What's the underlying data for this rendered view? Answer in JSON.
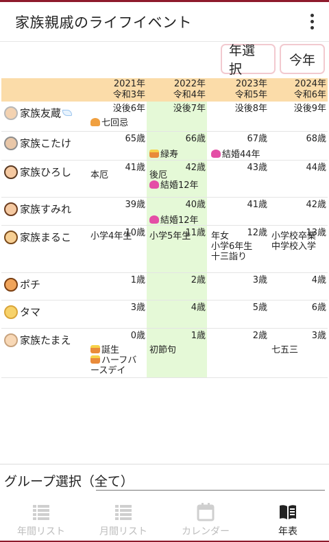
{
  "app": {
    "title": "家族親戚のライフイベント"
  },
  "buttons": {
    "year_select": "年選択",
    "this_year": "今年"
  },
  "years": [
    {
      "western": "2021年",
      "era": "令和3年"
    },
    {
      "western": "2022年",
      "era": "令和4年"
    },
    {
      "western": "2023年",
      "era": "令和5年"
    },
    {
      "western": "2024年",
      "era": "令和6年"
    }
  ],
  "rows": [
    {
      "name": "家族友蔵",
      "face": "elder-man-icon",
      "cells": [
        {
          "age": "没後6年",
          "events": [
            {
              "icon": "memorial-icon",
              "text": "七回忌"
            }
          ]
        },
        {
          "age": "没後7年",
          "events": []
        },
        {
          "age": "没後8年",
          "events": []
        },
        {
          "age": "没後9年",
          "events": []
        }
      ]
    },
    {
      "name": "家族こたけ",
      "face": "elder-woman-icon",
      "cells": [
        {
          "age": "65歳",
          "events": []
        },
        {
          "age": "66歳",
          "events": [
            {
              "icon": "cake-icon",
              "text": "緑寿"
            }
          ]
        },
        {
          "age": "67歳",
          "events": [
            {
              "icon": "hearts-icon",
              "text": "結婚44年"
            }
          ]
        },
        {
          "age": "68歳",
          "events": []
        }
      ]
    },
    {
      "name": "家族ひろし",
      "face": "man-icon",
      "cells": [
        {
          "age": "41歳",
          "events": [
            {
              "icon": "",
              "text": "本厄"
            }
          ]
        },
        {
          "age": "42歳",
          "events": [
            {
              "icon": "",
              "text": "後厄"
            },
            {
              "icon": "hearts-icon",
              "text": "結婚12年"
            }
          ]
        },
        {
          "age": "43歳",
          "events": []
        },
        {
          "age": "44歳",
          "events": []
        }
      ]
    },
    {
      "name": "家族すみれ",
      "face": "woman-icon",
      "cells": [
        {
          "age": "39歳",
          "events": []
        },
        {
          "age": "40歳",
          "events": [
            {
              "icon": "hearts-icon",
              "text": "結婚12年"
            }
          ]
        },
        {
          "age": "41歳",
          "events": []
        },
        {
          "age": "42歳",
          "events": []
        }
      ]
    },
    {
      "name": "家族まるこ",
      "face": "girl-icon",
      "cells": [
        {
          "age": "10歳",
          "events": [
            {
              "icon": "",
              "text": "小学4年生"
            }
          ]
        },
        {
          "age": "11歳",
          "events": [
            {
              "icon": "",
              "text": "小学5年生"
            }
          ]
        },
        {
          "age": "12歳",
          "events": [
            {
              "icon": "",
              "text": "年女"
            },
            {
              "icon": "",
              "text": "小学6年生"
            },
            {
              "icon": "",
              "text": "十三詣り"
            }
          ]
        },
        {
          "age": "13歳",
          "events": [
            {
              "icon": "",
              "text": "小学校卒業"
            },
            {
              "icon": "",
              "text": "中学校入学"
            }
          ]
        }
      ]
    },
    {
      "name": "ポチ",
      "face": "dog-icon",
      "cells": [
        {
          "age": "1歳",
          "events": []
        },
        {
          "age": "2歳",
          "events": []
        },
        {
          "age": "3歳",
          "events": []
        },
        {
          "age": "4歳",
          "events": []
        }
      ]
    },
    {
      "name": "タマ",
      "face": "cat-icon",
      "cells": [
        {
          "age": "3歳",
          "events": []
        },
        {
          "age": "4歳",
          "events": []
        },
        {
          "age": "5歳",
          "events": []
        },
        {
          "age": "6歳",
          "events": []
        }
      ]
    },
    {
      "name": "家族たまえ",
      "face": "baby-icon",
      "cells": [
        {
          "age": "0歳",
          "events": [
            {
              "icon": "cake-icon",
              "text": "誕生"
            },
            {
              "icon": "cake-icon",
              "text": "ハーフバ"
            },
            {
              "icon": "",
              "text": "ースデイ"
            }
          ]
        },
        {
          "age": "1歳",
          "events": [
            {
              "icon": "",
              "text": "初節句"
            }
          ]
        },
        {
          "age": "2歳",
          "events": []
        },
        {
          "age": "3歳",
          "events": [
            {
              "icon": "",
              "text": "七五三"
            }
          ]
        }
      ]
    }
  ],
  "group": {
    "label": "グループ選択（全て）"
  },
  "tabs": [
    {
      "label": "年間リスト",
      "icon": "list-icon",
      "active": false
    },
    {
      "label": "月間リスト",
      "icon": "list-icon",
      "active": false
    },
    {
      "label": "カレンダー",
      "icon": "calendar-icon",
      "active": false
    },
    {
      "label": "年表",
      "icon": "book-icon",
      "active": true
    }
  ],
  "colors": {
    "accent": "#8e1a2c",
    "header_bg": "#fbdca9",
    "highlight": "#e5f9d7",
    "pill_border": "#f2c9cf"
  }
}
